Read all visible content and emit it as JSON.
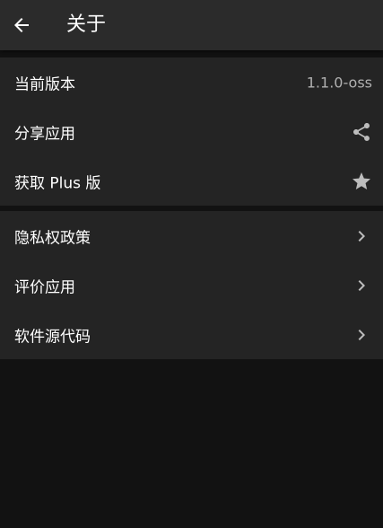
{
  "toolbar": {
    "title": "关于",
    "back_icon": "arrow-back-icon"
  },
  "sections": [
    {
      "items": [
        {
          "label": "当前版本",
          "value": "1.1.0-oss"
        },
        {
          "label": "分享应用",
          "icon": "share-icon"
        },
        {
          "label": "获取 Plus 版",
          "icon": "star-icon"
        }
      ]
    },
    {
      "items": [
        {
          "label": "隐私权政策",
          "icon": "chevron-right-icon"
        },
        {
          "label": "评价应用",
          "icon": "chevron-right-icon"
        },
        {
          "label": "软件源代码",
          "icon": "chevron-right-icon"
        }
      ]
    }
  ],
  "colors": {
    "background": "#121212",
    "toolbar": "#2b2b2b",
    "section": "#242424",
    "text_primary": "#ffffff",
    "text_secondary": "#b0b0b0",
    "icon": "#bdbdbd"
  }
}
